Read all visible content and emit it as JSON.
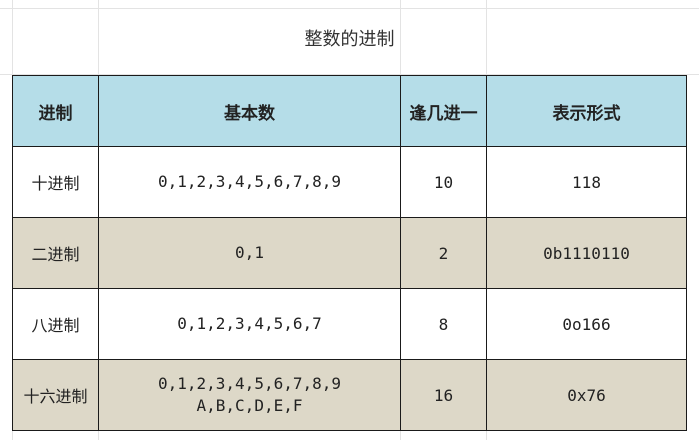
{
  "title": "整数的进制",
  "headers": [
    "进制",
    "基本数",
    "逢几进一",
    "表示形式"
  ],
  "rows": [
    {
      "name": "十进制",
      "digits": [
        "0,1,2,3,4,5,6,7,8,9"
      ],
      "carry": "10",
      "repr": "118"
    },
    {
      "name": "二进制",
      "digits": [
        "0,1"
      ],
      "carry": "2",
      "repr": "0b1110110"
    },
    {
      "name": "八进制",
      "digits": [
        "0,1,2,3,4,5,6,7"
      ],
      "carry": "8",
      "repr": "0o166"
    },
    {
      "name": "十六进制",
      "digits": [
        "0,1,2,3,4,5,6,7,8,9",
        "A,B,C,D,E,F"
      ],
      "carry": "16",
      "repr": "0x76"
    }
  ]
}
